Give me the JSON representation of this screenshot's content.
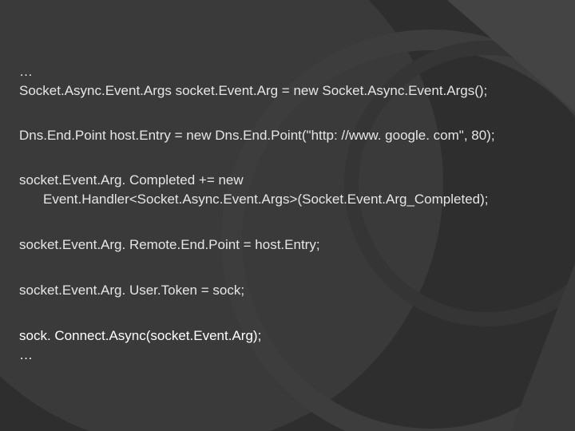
{
  "slide": {
    "lines": {
      "ellipsis_top": "…",
      "l1": "Socket.Async.Event.Args socket.Event.Arg = new Socket.Async.Event.Args();",
      "l2": "Dns.End.Point host.Entry = new Dns.End.Point(\"http: //www. google. com\", 80);",
      "l3a": "socket.Event.Arg. Completed += new",
      "l3b": "Event.Handler<Socket.Async.Event.Args>(Socket.Event.Arg_Completed);",
      "l4": "socket.Event.Arg. Remote.End.Point = host.Entry;",
      "l5": "socket.Event.Arg. User.Token = sock;",
      "l6": "sock. Connect.Async(socket.Event.Arg);",
      "ellipsis_bottom": "…"
    },
    "colors": {
      "background": "#2e2e2e",
      "text": "#e6e6e6",
      "text_bright": "#ffffff"
    }
  }
}
